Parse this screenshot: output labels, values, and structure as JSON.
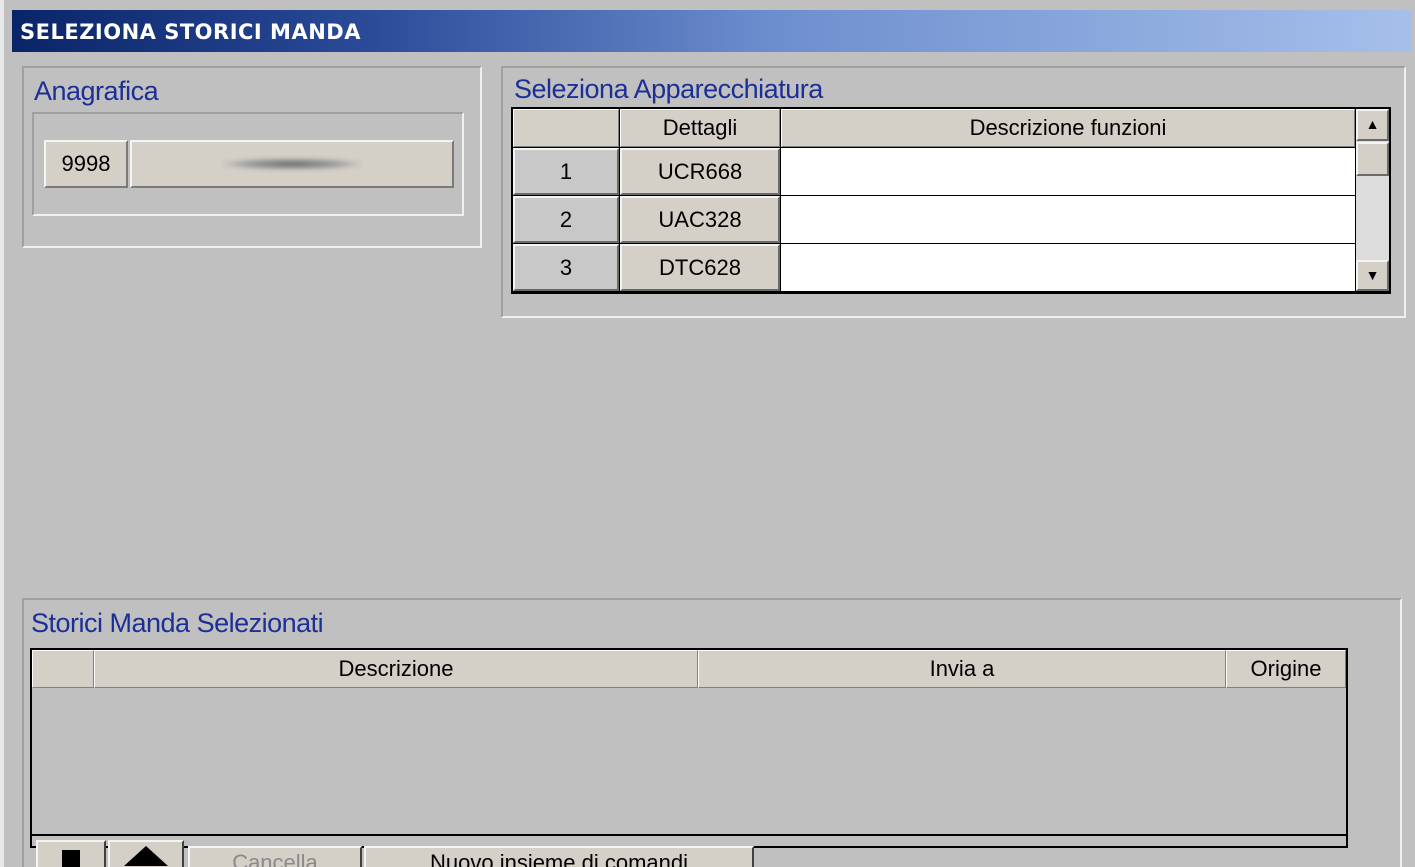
{
  "window": {
    "title": "SELEZIONA STORICI MANDA"
  },
  "anagrafica": {
    "title": "Anagrafica",
    "code": "9998"
  },
  "apparecchiatura": {
    "title": "Seleziona Apparecchiatura",
    "columns": [
      "",
      "Dettagli",
      "Descrizione funzioni"
    ],
    "rows": [
      {
        "num": "1",
        "dettagli": "UCR668",
        "descrizione": ""
      },
      {
        "num": "2",
        "dettagli": "UAC328",
        "descrizione": ""
      },
      {
        "num": "3",
        "dettagli": "DTC628",
        "descrizione": ""
      }
    ]
  },
  "storici": {
    "title": "Storici Manda Selezionati",
    "columns": [
      "",
      "Descrizione",
      "Invia a",
      "Origine"
    ],
    "buttons": [
      "Cancella",
      "Nuovo insieme di comandi"
    ]
  },
  "icons": {
    "scroll_up": "scroll-up-arrow-icon",
    "scroll_down": "scroll-down-arrow-icon",
    "delete": "delete-icon",
    "up": "up-arrow-icon"
  },
  "colors": {
    "title_bar_start": "#0a2468",
    "title_bar_end": "#a6c0ea",
    "group_title": "#1c2f96",
    "face": "#c0c0c0"
  }
}
